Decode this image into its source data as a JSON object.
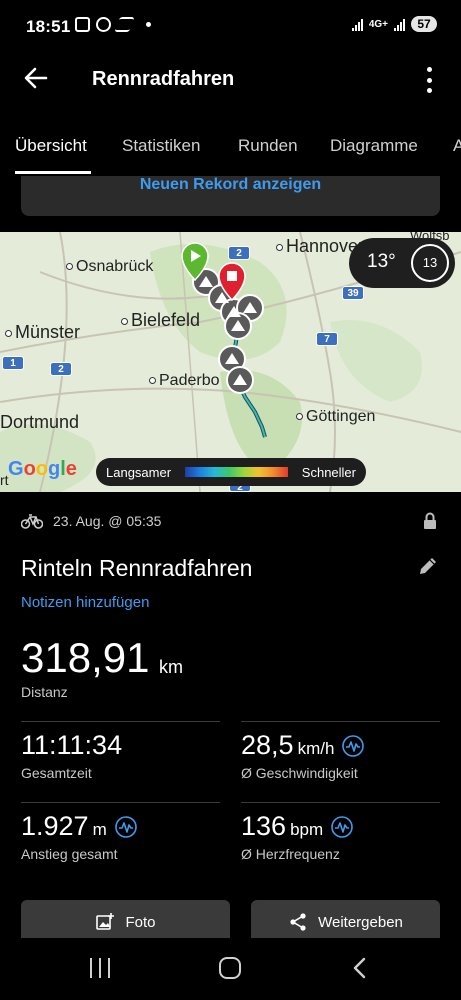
{
  "status_bar": {
    "time": "18:51",
    "network": "4G+",
    "battery": "57"
  },
  "app_bar": {
    "title": "Rennradfahren"
  },
  "tabs": [
    {
      "label": "Übersicht",
      "active": true
    },
    {
      "label": "Statistiken",
      "active": false
    },
    {
      "label": "Runden",
      "active": false
    },
    {
      "label": "Diagramme",
      "active": false
    },
    {
      "label": "A",
      "active": false
    }
  ],
  "record_card": {
    "link": "Neuen Rekord anzeigen"
  },
  "map": {
    "cities": [
      "Hannover",
      "Osnabrück",
      "Bielefeld",
      "Münster",
      "Paderbo",
      "Dortmund",
      "Göttingen",
      "Wolfsb",
      "rt"
    ],
    "road_shields": [
      "2",
      "2",
      "39",
      "7",
      "7",
      "1",
      "2"
    ],
    "weather": {
      "temperature": "13°",
      "wind": "13"
    },
    "google_logo": [
      "G",
      "o",
      "o",
      "g",
      "l",
      "e"
    ],
    "speed_legend": {
      "slow": "Langsamer",
      "fast": "Schneller"
    }
  },
  "activity": {
    "date": "23. Aug. @ 05:35",
    "title": "Rinteln Rennradfahren",
    "notes_link": "Notizen hinzufügen",
    "distance": {
      "value": "318,91",
      "unit": "km",
      "label": "Distanz"
    },
    "stats": [
      {
        "value": "11:11:34",
        "unit": "",
        "label": "Gesamtzeit",
        "has_chart_icon": false
      },
      {
        "value": "28,5",
        "unit": "km/h",
        "label": "Ø Geschwindigkeit",
        "has_chart_icon": true
      },
      {
        "value": "1.927",
        "unit": "m",
        "label": "Anstieg gesamt",
        "has_chart_icon": true
      },
      {
        "value": "136",
        "unit": "bpm",
        "label": "Ø Herzfrequenz",
        "has_chart_icon": true
      }
    ]
  },
  "buttons": {
    "photo": "Foto",
    "share": "Weitergeben"
  },
  "colors": {
    "accent": "#3e9bef",
    "background": "#000000",
    "card": "#2b2b2b",
    "start_marker": "#5cb82e",
    "end_marker": "#e0202e"
  }
}
